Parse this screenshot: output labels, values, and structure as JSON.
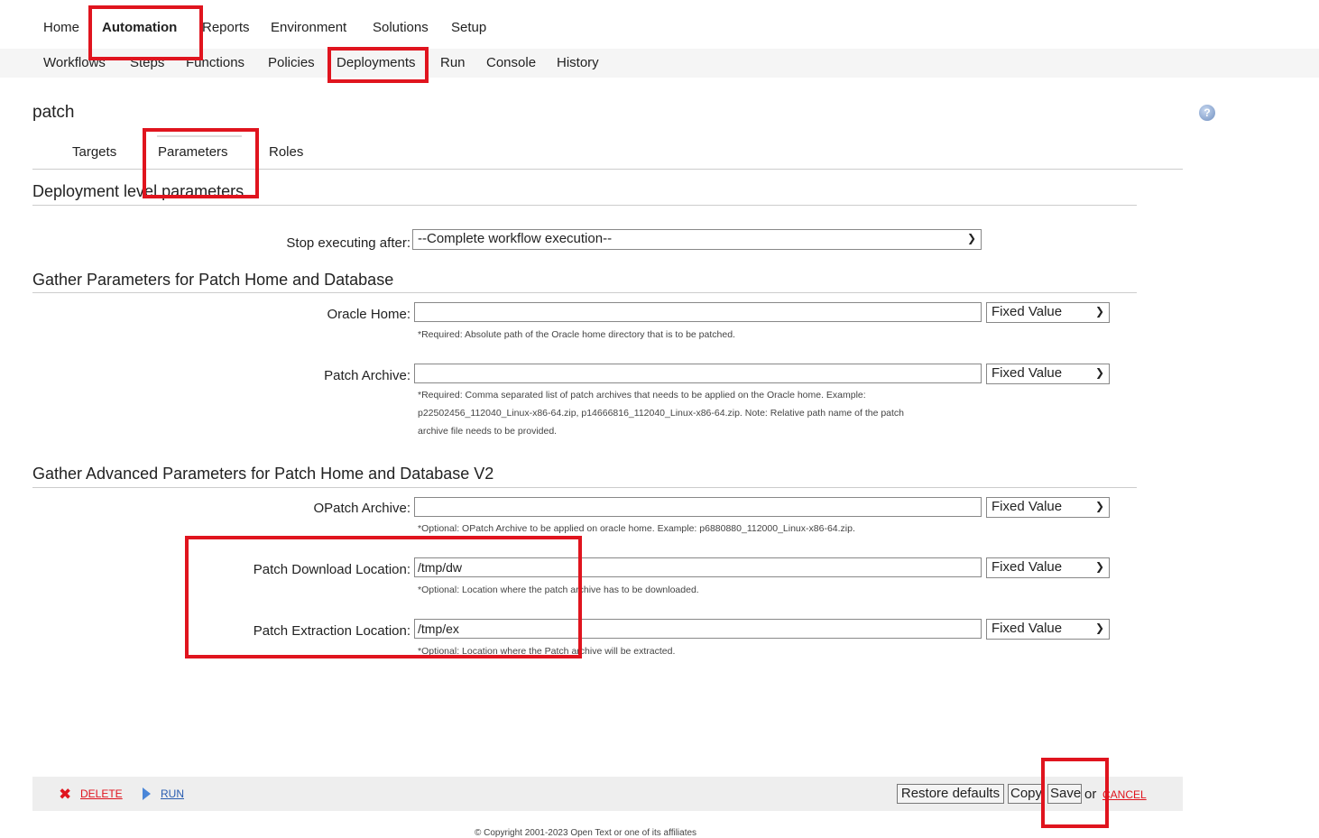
{
  "nav": {
    "top": [
      "Home",
      "Automation",
      "Reports",
      "Environment",
      "Solutions",
      "Setup"
    ],
    "sub": [
      "Workflows",
      "Steps",
      "Functions",
      "Policies",
      "Deployments",
      "Run",
      "Console",
      "History"
    ]
  },
  "page": {
    "title": "patch",
    "help_icon": "question-icon"
  },
  "tabs": [
    "Targets",
    "Parameters",
    "Roles"
  ],
  "sections": {
    "deployment": "Deployment level parameters",
    "gather": "Gather Parameters for Patch Home and Database",
    "advanced": "Gather Advanced Parameters for Patch Home and Database V2"
  },
  "stop": {
    "label": "Stop executing after:",
    "value": "--Complete workflow execution--"
  },
  "fields": [
    {
      "label": "Oracle Home:",
      "value": "",
      "mode": "Fixed Value",
      "hint": [
        "*Required: Absolute path of the Oracle home directory that is to be patched."
      ]
    },
    {
      "label": "Patch Archive:",
      "value": "",
      "mode": "Fixed Value",
      "hint": [
        "*Required: Comma separated list of patch archives that needs to be applied on the Oracle home. Example:",
        "p22502456_112040_Linux-x86-64.zip, p14666816_112040_Linux-x86-64.zip. Note: Relative path name of the patch",
        "archive file needs to be provided."
      ]
    },
    {
      "label": "OPatch Archive:",
      "value": "",
      "mode": "Fixed Value",
      "hint": [
        "*Optional: OPatch Archive to be applied on oracle home. Example: p6880880_112000_Linux-x86-64.zip."
      ]
    },
    {
      "label": "Patch Download Location:",
      "value": "/tmp/dw",
      "mode": "Fixed Value",
      "hint": [
        "*Optional: Location where the patch archive has to be downloaded."
      ]
    },
    {
      "label": "Patch Extraction Location:",
      "value": "/tmp/ex",
      "mode": "Fixed Value",
      "hint": [
        "*Optional: Location where the Patch archive will be extracted."
      ]
    }
  ],
  "footer": {
    "delete": "DELETE",
    "run": "RUN",
    "restore": "Restore defaults",
    "copy": "Copy",
    "save": "Save",
    "or": "or",
    "cancel": "CANCEL",
    "copyright": "© Copyright 2001-2023 Open Text or one of its affiliates"
  },
  "colors": {
    "highlight": "#e0141e",
    "link": "#2a5db0"
  }
}
